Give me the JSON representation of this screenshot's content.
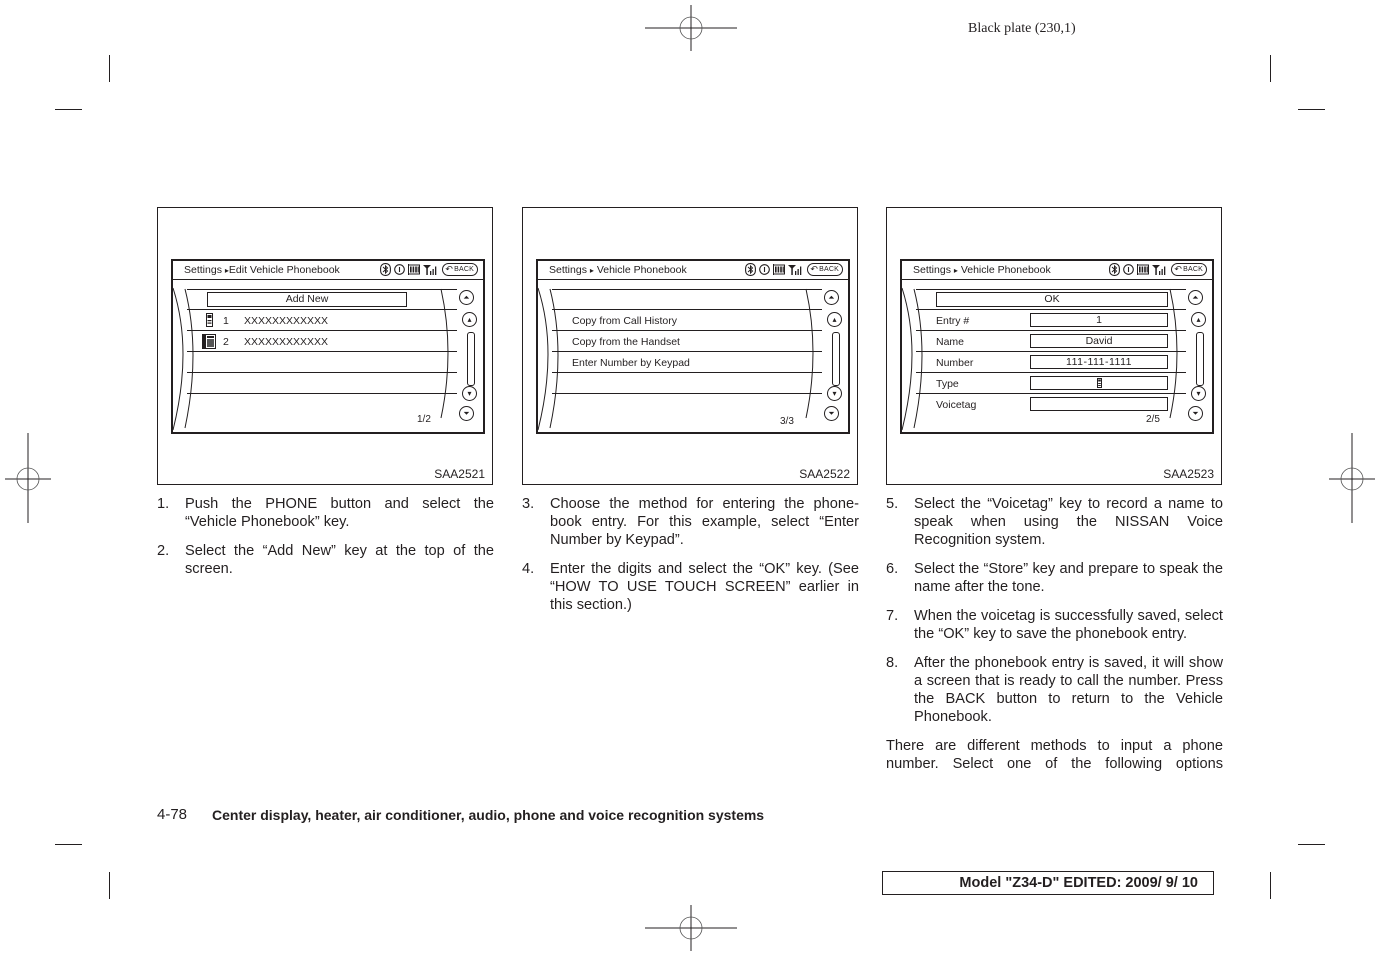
{
  "plate_label": "Black plate (230,1)",
  "figures": [
    {
      "code": "SAA2521",
      "screen": {
        "breadcrumb_root": "Settings",
        "breadcrumb_sep": "▸",
        "breadcrumb_page": "Edit Vehicle Phonebook",
        "back_label": "BACK",
        "top_button": "Add New",
        "entries": [
          {
            "icon": "mobile-phone-icon",
            "index": "1",
            "value": "XXXXXXXXXXXX"
          },
          {
            "icon": "home-phone-icon",
            "index": "2",
            "value": "XXXXXXXXXXXX"
          }
        ],
        "page_indicator": "1/2"
      }
    },
    {
      "code": "SAA2522",
      "screen": {
        "breadcrumb_root": "Settings",
        "breadcrumb_sep": "▸",
        "breadcrumb_page": "Vehicle Phonebook",
        "back_label": "BACK",
        "options": [
          "Copy from Call History",
          "Copy from the Handset",
          "Enter Number by Keypad"
        ],
        "page_indicator": "3/3"
      }
    },
    {
      "code": "SAA2523",
      "screen": {
        "breadcrumb_root": "Settings",
        "breadcrumb_sep": "▸",
        "breadcrumb_page": "Vehicle Phonebook",
        "back_label": "BACK",
        "top_button": "OK",
        "fields": [
          {
            "label": "Entry #",
            "value": "1"
          },
          {
            "label": "Name",
            "value": "David"
          },
          {
            "label": "Number",
            "value": "111-111-1111"
          },
          {
            "label": "Type",
            "value": "▯"
          },
          {
            "label": "Voicetag",
            "value": ""
          }
        ],
        "page_indicator": "2/5"
      }
    }
  ],
  "steps": [
    {
      "num": "1.",
      "text": "Push the PHONE button and select the “Vehicle Phonebook” key."
    },
    {
      "num": "2.",
      "text": "Select the “Add New” key at the top of the screen."
    },
    {
      "num": "3.",
      "text": "Choose the method for entering the phone-book entry. For this example, select “Enter Number by Keypad”."
    },
    {
      "num": "4.",
      "text": "Enter the digits and select the “OK” key. (See “HOW TO USE TOUCH SCREEN” earlier in this section.)"
    },
    {
      "num": "5.",
      "text": "Select the “Voicetag” key to record a name to speak when using the NISSAN Voice Recognition system."
    },
    {
      "num": "6.",
      "text": "Select the “Store” key and prepare to speak the name after the tone."
    },
    {
      "num": "7.",
      "text": "When the voicetag is successfully saved, select the “OK” key to save the phonebook entry."
    },
    {
      "num": "8.",
      "text": "After the phonebook entry is saved, it will show a screen that is ready to call the number. Press the BACK button to return to the Vehicle Phonebook."
    }
  ],
  "closing_paragraph": "There are different methods to input a phone number. Select one of the following options",
  "footer": {
    "page_number": "4-78",
    "section_title": "Center display, heater, air conditioner, audio, phone and voice recognition systems",
    "model_label": "Model \"Z34-D\"  EDITED:  2009/ 9/ 10"
  }
}
